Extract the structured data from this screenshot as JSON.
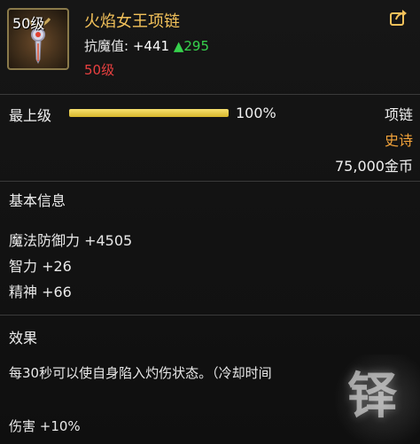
{
  "item": {
    "name": "火焰女王项链",
    "icon_level": "50级",
    "stat_label": "抗魔值:",
    "stat_value": "+441",
    "stat_increase": "▲295",
    "required_level": "50级"
  },
  "level": {
    "label": "最上级",
    "percent_text": "100%",
    "progress_fraction": 1.0
  },
  "meta": {
    "type": "项链",
    "rarity": "史诗",
    "price": "75,000金币"
  },
  "basic_info": {
    "title": "基本信息",
    "stats": [
      "魔法防御力 +4505",
      "智力 +26",
      "精神 +66"
    ]
  },
  "effect": {
    "title": "效果",
    "description": "每30秒可以使自身陷入灼伤状态。（冷却时间",
    "damage": "伤害 +10%"
  },
  "icons": {
    "share": "share-icon",
    "item": "necklace-icon"
  },
  "watermark": "铎"
}
